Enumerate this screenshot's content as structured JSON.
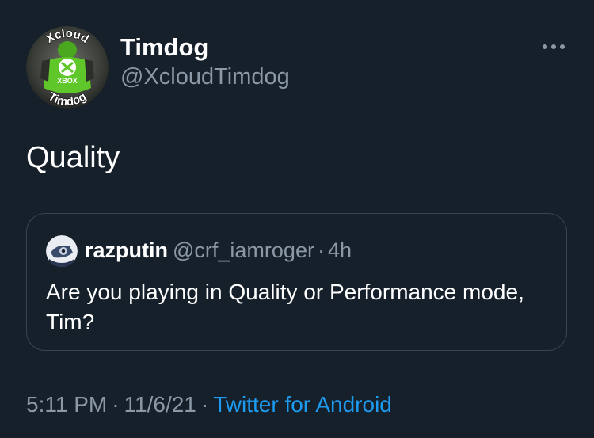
{
  "tweet": {
    "author": {
      "name": "Timdog",
      "handle": "@XcloudTimdog",
      "avatar_text_top": "Xcloud",
      "avatar_text_mid": "XBOX",
      "avatar_text_bottom": "Timdog"
    },
    "more_icon": "more-horizontal-icon",
    "text": "Quality",
    "quoted": {
      "name": "razputin",
      "handle": "@crf_iamroger",
      "separator": "·",
      "time": "4h",
      "text": "Are you playing in Quality or Performance mode, Tim?"
    },
    "time": "5:11 PM",
    "date": "11/6/21",
    "separator": "·",
    "source": "Twitter for Android"
  },
  "colors": {
    "background": "#15202b",
    "primary_text": "#ffffff",
    "secondary_text": "#8b98a5",
    "border": "#38444d",
    "link": "#1d9bf0",
    "avatar_green": "#5fc72a"
  }
}
